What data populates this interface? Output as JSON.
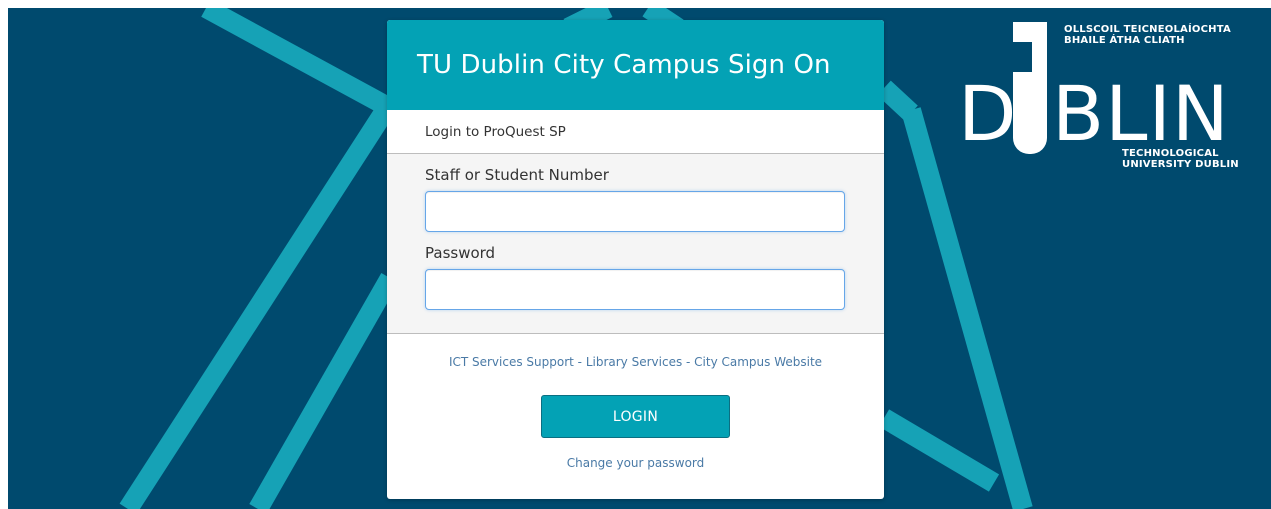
{
  "colors": {
    "background": "#004a6e",
    "accent": "#03a2b5",
    "link": "#4a7aa6"
  },
  "card": {
    "title": "TU Dublin City Campus Sign On",
    "service": "Login to ProQuest SP",
    "fields": {
      "username_label": "Staff or Student Number",
      "username_value": "",
      "password_label": "Password",
      "password_value": ""
    },
    "links": {
      "ict": "ICT Services Support",
      "separator": " - ",
      "library": "Library Services",
      "website": "City Campus Website"
    },
    "login_label": "LOGIN",
    "change_password": "Change your password"
  },
  "logo": {
    "irish_line1": "OLLSCOIL TEICNEOLAÍOCHTA",
    "irish_line2": "BHAILE ÁTHA CLIATH",
    "word_left": "D",
    "word_right": "BLIN",
    "english_line1": "TECHNOLOGICAL",
    "english_line2": "UNIVERSITY DUBLIN"
  }
}
